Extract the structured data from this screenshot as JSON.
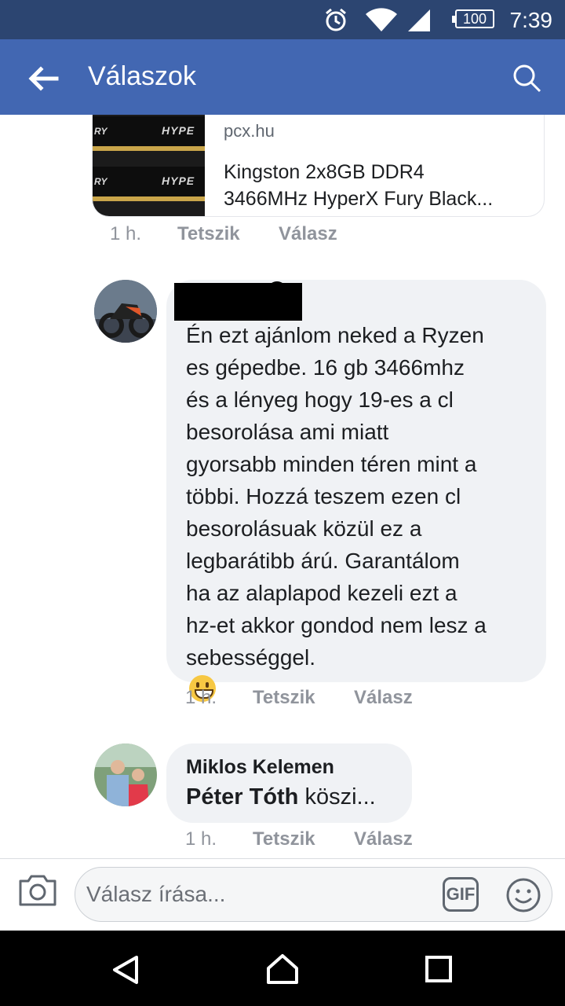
{
  "status_bar": {
    "time": "7:39",
    "battery": "100",
    "icons": [
      "alarm-icon",
      "wifi-icon",
      "signal-icon",
      "battery-icon"
    ]
  },
  "app_bar": {
    "title": "Válaszok",
    "icons": [
      "back-arrow-icon",
      "search-icon"
    ]
  },
  "link_preview": {
    "domain": "pcx.hu",
    "title_line1": "Kingston 2x8GB DDR4",
    "title_line2": "3466MHz HyperX Fury Black...",
    "thumb_logo": "HYPE",
    "thumb_logo_left": "RY"
  },
  "meta_link": {
    "time": "1 h.",
    "like": "Tetszik",
    "reply": "Válasz"
  },
  "comment1": {
    "author_redacted": true,
    "lines": [
      "Én ezt ajánlom neked a Ryzen",
      "es gépedbe. 16 gb 3466mhz",
      "és a lényeg hogy 19-es a cl",
      "besorolása ami miatt",
      "gyorsabb minden téren mint a",
      "többi. Hozzá teszem ezen cl",
      "besorolásuak közül ez a",
      "legbarátibb árú. Garantálom",
      "ha az alaplapod kezeli ezt a",
      "hz-et akkor gondod nem lesz a",
      "sebességgel."
    ],
    "emoji": "grinning-face"
  },
  "meta_comment1": {
    "time": "1 h.",
    "like": "Tetszik",
    "reply": "Válasz"
  },
  "comment2": {
    "author": "Miklos Kelemen",
    "mention": "Péter Tóth",
    "text": " köszi..."
  },
  "meta_comment2": {
    "time": "1 h.",
    "like": "Tetszik",
    "reply": "Válasz"
  },
  "composer": {
    "placeholder": "Válasz írása...",
    "gif_label": "GIF",
    "icons": [
      "camera-icon",
      "gif-icon",
      "emoji-icon"
    ]
  },
  "nav_bar": {
    "icons": [
      "nav-back-icon",
      "nav-home-icon",
      "nav-recent-icon"
    ]
  },
  "colors": {
    "app_bar": "#4267b2",
    "status_bar": "#2c4571",
    "bubble": "#f0f2f5"
  }
}
